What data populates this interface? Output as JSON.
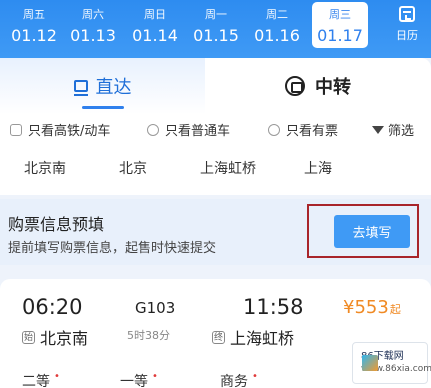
{
  "date_strip": {
    "dates": [
      {
        "weekday": "周五",
        "date": "01.12"
      },
      {
        "weekday": "周六",
        "date": "01.13"
      },
      {
        "weekday": "周日",
        "date": "01.14"
      },
      {
        "weekday": "周一",
        "date": "01.15"
      },
      {
        "weekday": "周二",
        "date": "01.16"
      },
      {
        "weekday": "周三",
        "date": "01.17"
      }
    ],
    "selected_index": 5,
    "calendar_label": "日历"
  },
  "tabs": {
    "direct": "直达",
    "transfer": "中转"
  },
  "filters": {
    "high_speed": "只看高铁/动车",
    "regular": "只看普通车",
    "available": "只看有票",
    "filter": "筛选"
  },
  "stations": [
    "北京南",
    "北京",
    "上海虹桥",
    "上海"
  ],
  "prefill": {
    "title": "购票信息预填",
    "desc": "提前填写购票信息，起售时快速提交",
    "button": "去填写"
  },
  "train": {
    "dep_time": "06:20",
    "train_no": "G103",
    "arr_time": "11:58",
    "price": "¥553",
    "price_suffix": "起",
    "dep_badge": "始",
    "dep_station": "北京南",
    "duration": "5时38分",
    "arr_badge": "终",
    "arr_station": "上海虹桥",
    "seats": [
      "二等",
      "一等",
      "商务"
    ]
  },
  "watermark": {
    "title": "86下载网",
    "url": "www.86xia.com"
  },
  "colors": {
    "primary": "#2f80ed",
    "price": "#f08a24",
    "highlight_border": "#a8252a"
  }
}
